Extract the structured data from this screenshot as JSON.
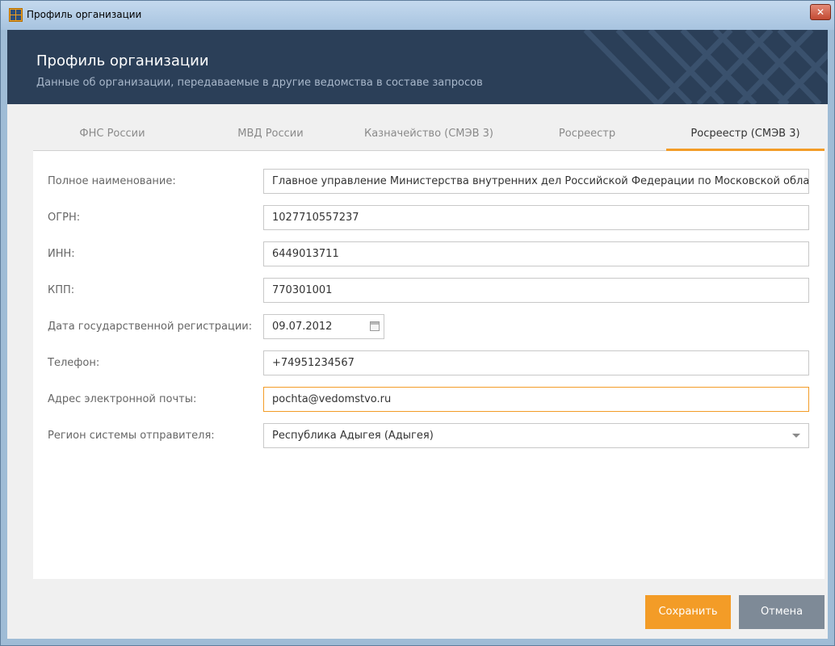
{
  "window": {
    "title": "Профиль организации",
    "close_glyph": "✕"
  },
  "header": {
    "title": "Профиль организации",
    "subtitle": "Данные об организации, передаваемые в другие ведомства в составе запросов"
  },
  "tabs": [
    {
      "label": "ФНС России",
      "active": false
    },
    {
      "label": "МВД России",
      "active": false
    },
    {
      "label": "Казначейство (СМЭВ 3)",
      "active": false
    },
    {
      "label": "Росреестр",
      "active": false
    },
    {
      "label": "Росреестр (СМЭВ 3)",
      "active": true
    }
  ],
  "form": {
    "full_name": {
      "label": "Полное наименование:",
      "value": "Главное управление Министерства внутренних дел Российской Федерации по Московской области"
    },
    "ogrn": {
      "label": "ОГРН:",
      "value": "1027710557237"
    },
    "inn": {
      "label": "ИНН:",
      "value": "6449013711"
    },
    "kpp": {
      "label": "КПП:",
      "value": "770301001"
    },
    "reg_date": {
      "label": "Дата государственной регистрации:",
      "value": "09.07.2012"
    },
    "phone": {
      "label": "Телефон:",
      "value": "+74951234567"
    },
    "email": {
      "label": "Адрес электронной почты:",
      "value": "pochta@vedomstvo.ru"
    },
    "region": {
      "label": "Регион системы отправителя:",
      "value": "Республика Адыгея (Адыгея)"
    }
  },
  "buttons": {
    "save": "Сохранить",
    "cancel": "Отмена"
  },
  "colors": {
    "accent": "#f39c27",
    "header_bg": "#2b3f58",
    "cancel_bg": "#7e8a97"
  },
  "icons": {
    "app": "app-grid-icon",
    "close": "close-icon",
    "calendar": "calendar-icon",
    "dropdown": "chevron-down-icon"
  }
}
